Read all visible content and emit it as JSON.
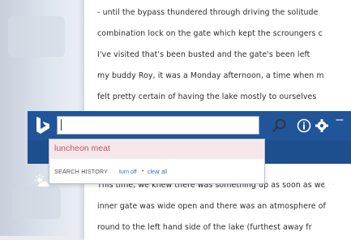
{
  "document": {
    "lines_top": [
      "- until the bypass thundered through driving the solitude",
      "combination lock on the gate which kept the scroungers c",
      "I've visited that's been busted and the gate's been left",
      "my buddy Roy, it was a Monday afternoon, a time when m",
      "felt pretty certain of having the lake mostly to ourselves"
    ],
    "lines_bottom": [
      "This time, we knew there was something up as soon as we",
      "inner gate was wide open and there was an atmosphere of",
      "round to the left hand side of the lake (furthest away fr"
    ]
  },
  "bing_bar": {
    "search": {
      "value": "",
      "placeholder": ""
    },
    "icons": {
      "logo": "bing-logo-icon",
      "search": "search-icon",
      "info": "info-icon",
      "settings": "gear-icon",
      "minimize": "minimize-icon",
      "weather": "weather-icon",
      "more": "more-icon"
    },
    "minimize_label": "–",
    "more_label": "..."
  },
  "suggestions": {
    "items": [
      {
        "label": "luncheon meat"
      }
    ],
    "history_label": "SEARCH HISTORY",
    "turn_off_label": "turn off",
    "separator": "•",
    "clear_all_label": "clear all"
  },
  "colors": {
    "bar_blue": "#20559a",
    "bar_blue_dark": "#1d4f8f",
    "suggestion_bg": "#f6e8ea",
    "suggestion_text": "#c0525f",
    "link": "#3a6fb5"
  }
}
